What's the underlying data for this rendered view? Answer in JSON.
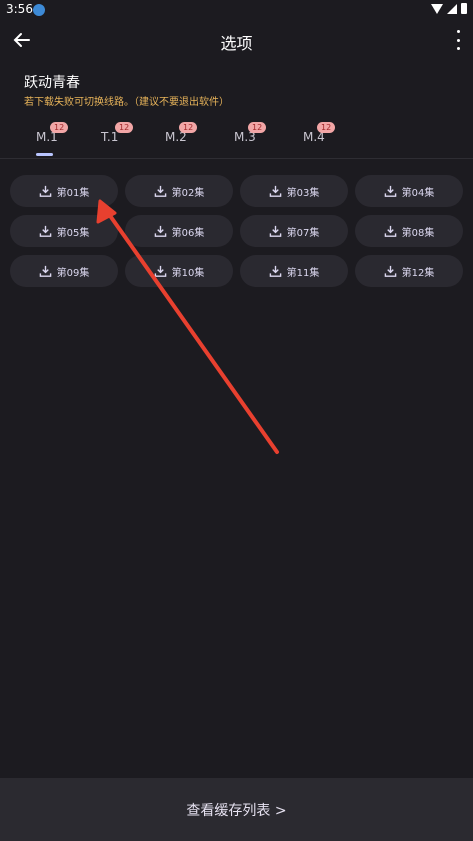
{
  "status_bar": {
    "time": "3:56"
  },
  "app_bar": {
    "title": "选项"
  },
  "show": {
    "title": "跃动青春",
    "notice": "若下载失败可切换线路。（建议不要退出软件）"
  },
  "tabs": [
    {
      "label": "M.1",
      "count": "12"
    },
    {
      "label": "T.1",
      "count": "12"
    },
    {
      "label": "M.2",
      "count": "12"
    },
    {
      "label": "M.3",
      "count": "12"
    },
    {
      "label": "M.4",
      "count": "12"
    }
  ],
  "selected_tab": "M.1",
  "episodes": [
    "第01集",
    "第02集",
    "第03集",
    "第04集",
    "第05集",
    "第06集",
    "第07集",
    "第08集",
    "第09集",
    "第10集",
    "第11集",
    "第12集"
  ],
  "footer": {
    "link": "查看缓存列表 >"
  },
  "colors": {
    "accent": "#b9c5ff",
    "badge": "#f2a6a6",
    "notice": "#e8b45a",
    "arrow": "#e8402f"
  }
}
